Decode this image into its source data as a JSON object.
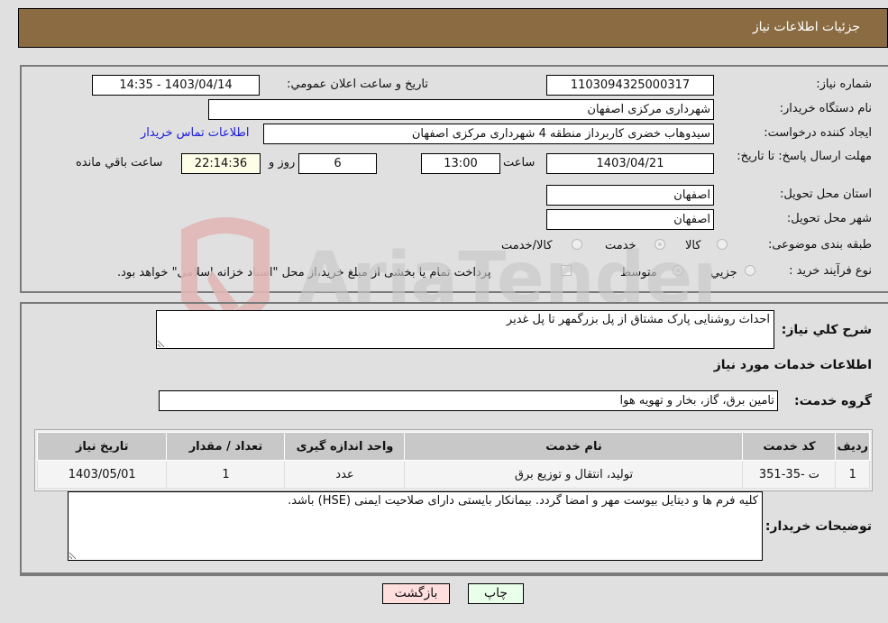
{
  "header": {
    "title": "جزئیات اطلاعات نیاز"
  },
  "form": {
    "need_number": {
      "label": "شماره نیاز:",
      "value": "1103094325000317"
    },
    "announce_datetime": {
      "label": "تاریخ و ساعت اعلان عمومي:",
      "value": "1403/04/14 - 14:35"
    },
    "buyer_org": {
      "label": "نام دستگاه خریدار:",
      "value": "شهرداری مرکزی اصفهان"
    },
    "requester": {
      "label": "ایجاد کننده درخواست:",
      "value": "سیدوهاب خضری کاربرداز منطقه 4 شهرداری مرکزی اصفهان"
    },
    "buyer_contact_link": "اطلاعات تماس خریدار",
    "deadline": {
      "label": "مهلت ارسال پاسخ: تا تاریخ:",
      "date": "1403/04/21",
      "time_label": "ساعت",
      "time": "13:00",
      "days": "6",
      "days_label": "روز و",
      "remaining": "22:14:36",
      "remaining_label": "ساعت باقي مانده"
    },
    "province": {
      "label": "استان محل تحویل:",
      "value": "اصفهان"
    },
    "city": {
      "label": "شهر محل تحویل:",
      "value": "اصفهان"
    },
    "category": {
      "label": "طبقه بندی موضوعی:",
      "options": [
        "کالا",
        "خدمت",
        "کالا/خدمت"
      ],
      "selected": "خدمت"
    },
    "purchase_type": {
      "label": "نوع فرآیند خرید :",
      "options": [
        "جزیي",
        "متوسط"
      ],
      "selected": "متوسط",
      "treasury_note": "پرداخت تمام یا بخشی از مبلغ خرید،از محل \"اسناد خزانه اسلامی\" خواهد بود."
    }
  },
  "details": {
    "description_label": "شرح کلي نیاز:",
    "description": "احداث روشنایی پارک مشتاق از پل بزرگمهر تا پل غدیر",
    "services_heading": "اطلاعات خدمات مورد نیاز",
    "service_group_label": "گروه خدمت:",
    "service_group": "تامین برق، گاز، بخار و تهویه هوا",
    "table": {
      "columns": [
        "ردیف",
        "کد خدمت",
        "نام خدمت",
        "واحد اندازه گیری",
        "تعداد / مقدار",
        "تاریخ نیاز"
      ],
      "rows": [
        [
          "1",
          "ت -35-351",
          "تولید، انتقال و توزیع برق",
          "عدد",
          "1",
          "1403/05/01"
        ]
      ]
    },
    "buyer_notes_label": "توضیحات خریدار:",
    "buyer_notes": "کلیه فرم ها و دیتایل بیوست مهر و امضا گردد. بیمانکار بایستی دارای صلاحیت ایمنی (HSE) باشد."
  },
  "buttons": {
    "print": "چاپ",
    "back": "بازگشت"
  },
  "watermark": {
    "text": "AriaTender.neT"
  },
  "colors": {
    "header_bg": "#8b6c42",
    "back_btn": "#ffdede",
    "print_btn": "#eaffea",
    "link": "#1a1adc"
  }
}
